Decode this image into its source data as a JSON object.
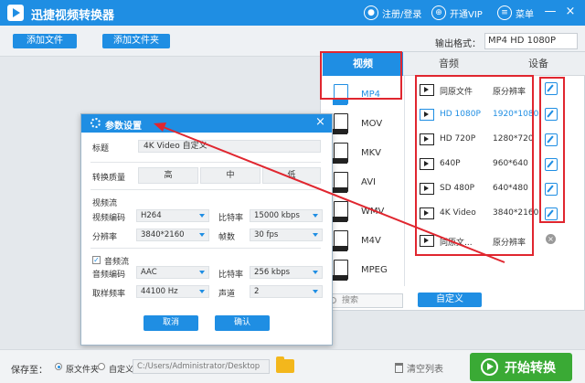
{
  "app": {
    "title": "迅捷视频转换器"
  },
  "titlebar": {
    "login": "注册/登录",
    "vip": "开通VIP",
    "menu": "菜单",
    "minimize": "—",
    "close": "×"
  },
  "toolbar": {
    "add_file": "添加文件",
    "add_folder": "添加文件夹",
    "output_format_label": "输出格式：",
    "output_format_value": "MP4  HD 1080P"
  },
  "format_panel": {
    "tabs": [
      "视频",
      "音频",
      "设备"
    ],
    "formats": [
      {
        "name": "MP4"
      },
      {
        "name": "MOV"
      },
      {
        "name": "MKV"
      },
      {
        "name": "AVI"
      },
      {
        "name": "WMV"
      },
      {
        "name": "M4V"
      },
      {
        "name": "MPEG"
      }
    ],
    "presets": [
      {
        "name": "同原文件",
        "res": "原分辨率"
      },
      {
        "name": "HD 1080P",
        "res": "1920*1080"
      },
      {
        "name": "HD 720P",
        "res": "1280*720"
      },
      {
        "name": "640P",
        "res": "960*640"
      },
      {
        "name": "SD 480P",
        "res": "640*480"
      },
      {
        "name": "4K Video",
        "res": "3840*2160"
      },
      {
        "name": "同原文...",
        "res": "原分辨率"
      }
    ],
    "search_placeholder": "搜索",
    "custom_button": "自定义"
  },
  "dialog": {
    "title": "参数设置",
    "close": "×",
    "title_label": "标题",
    "title_value": "4K Video 自定义",
    "quality_label": "转换质量",
    "quality_options": [
      "高",
      "中",
      "低"
    ],
    "video_stream": "视频流",
    "video_codec_label": "视频编码",
    "video_codec": "H264",
    "bitrate_label": "比特率",
    "video_bitrate": "15000 kbps",
    "resolution_label": "分辨率",
    "resolution": "3840*2160",
    "fps_label": "帧数",
    "fps": "30 fps",
    "audio_stream": "音频流",
    "audio_checked": "✓",
    "audio_codec_label": "音频编码",
    "audio_codec": "AAC",
    "audio_bitrate_label": "比特率",
    "audio_bitrate": "256 kbps",
    "sample_rate_label": "取样频率",
    "sample_rate": "44100 Hz",
    "channel_label": "声道",
    "channel": "2",
    "cancel": "取消",
    "ok": "确认"
  },
  "bottombar": {
    "save_to": "保存至：",
    "option_source": "原文件夹",
    "option_custom": "自定义",
    "path": "C:/Users/Administrator/Desktop",
    "clear_list": "清空列表",
    "start": "开始转换"
  },
  "colors": {
    "accent": "#1f8ee3",
    "start": "#3aaa35",
    "highlight": "#e0262f"
  }
}
